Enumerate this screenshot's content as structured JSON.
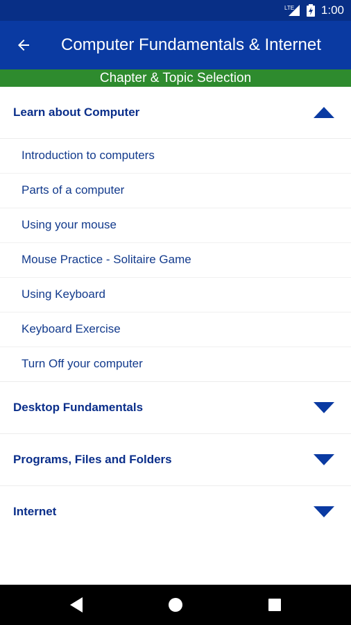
{
  "status_bar": {
    "time": "1:00",
    "network_label": "LTE",
    "background": "#082f86"
  },
  "app_bar": {
    "title": "Computer Fundamentals & Internet",
    "back_icon": "arrow-left-icon",
    "background": "#0a3aa2"
  },
  "subheader": {
    "label": "Chapter & Topic Selection",
    "background": "#2e8b2e"
  },
  "chapters": [
    {
      "title": "Learn about Computer",
      "expanded": true,
      "toggle_icon": "triangle-up-icon",
      "topics": [
        "Introduction to computers",
        "Parts of a computer",
        "Using your mouse",
        "Mouse Practice - Solitaire Game",
        "Using Keyboard",
        "Keyboard Exercise",
        "Turn Off your computer"
      ]
    },
    {
      "title": "Desktop Fundamentals",
      "expanded": false,
      "toggle_icon": "triangle-down-icon"
    },
    {
      "title": "Programs, Files and Folders",
      "expanded": false,
      "toggle_icon": "triangle-down-icon"
    },
    {
      "title": "Internet",
      "expanded": false,
      "toggle_icon": "triangle-down-icon"
    }
  ],
  "nav_bar": {
    "buttons": [
      "back-triangle-icon",
      "home-circle-icon",
      "recents-square-icon"
    ]
  },
  "colors": {
    "accent": "#0a2e8a",
    "topic_text": "#123a8c"
  }
}
